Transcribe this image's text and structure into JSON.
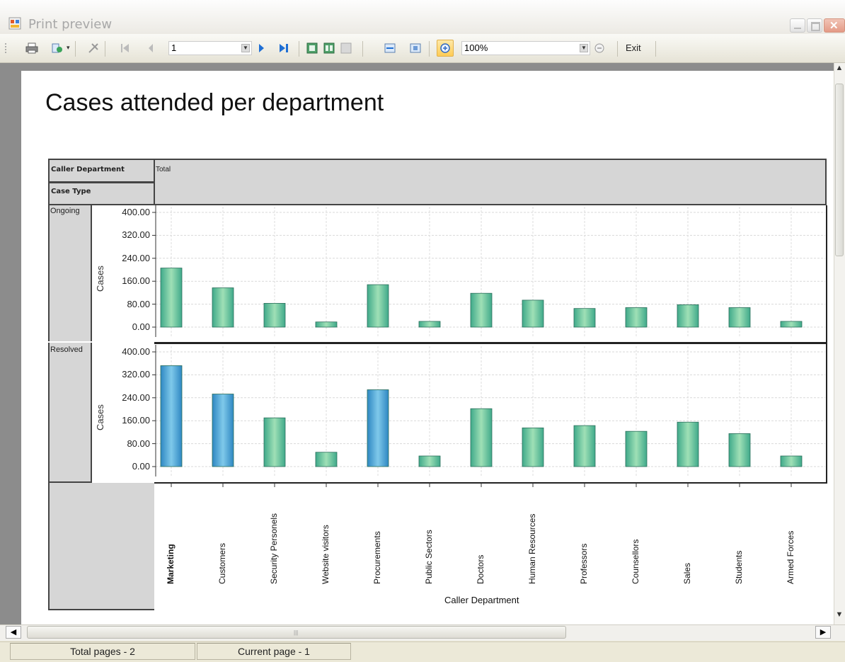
{
  "window": {
    "title": "Print preview"
  },
  "toolbar": {
    "page_input": "1",
    "zoom_value": "100%",
    "exit_label": "Exit"
  },
  "report": {
    "title": "Cases attended per department",
    "header": {
      "row_field_1": "Caller Department",
      "row_field_2": "Case Type",
      "column_value": "Total"
    },
    "row_labels": [
      "Ongoing",
      "Resolved"
    ]
  },
  "chart_data": {
    "type": "bar",
    "xlabel": "Caller Department",
    "ylabel": "Cases",
    "ylim": [
      0,
      400
    ],
    "yticks": [
      "400.00",
      "320.00",
      "240.00",
      "160.00",
      "80.00",
      "0.00"
    ],
    "grid": true,
    "categories": [
      "Marketing",
      "Customers",
      "Security Personels",
      "Website visitors",
      "Procurements",
      "Public Sectors",
      "Doctors",
      "Human Resources",
      "Professors",
      "Counsellors",
      "Sales",
      "Students",
      "Armed Forces"
    ],
    "series": [
      {
        "name": "Ongoing",
        "values": [
          206,
          137,
          83,
          18,
          148,
          20,
          118,
          94,
          65,
          68,
          78,
          68,
          20
        ]
      },
      {
        "name": "Resolved",
        "values": [
          352,
          253,
          170,
          50,
          268,
          37,
          202,
          135,
          143,
          123,
          155,
          115,
          37
        ]
      }
    ],
    "colors": {
      "green_dark": "#3fa98a",
      "green_light": "#9fe0b6",
      "blue_dark": "#2e87c2",
      "blue_light": "#7fc9ea"
    }
  },
  "statusbar": {
    "total_pages": "Total pages - 2",
    "current_page": "Current page - 1"
  }
}
